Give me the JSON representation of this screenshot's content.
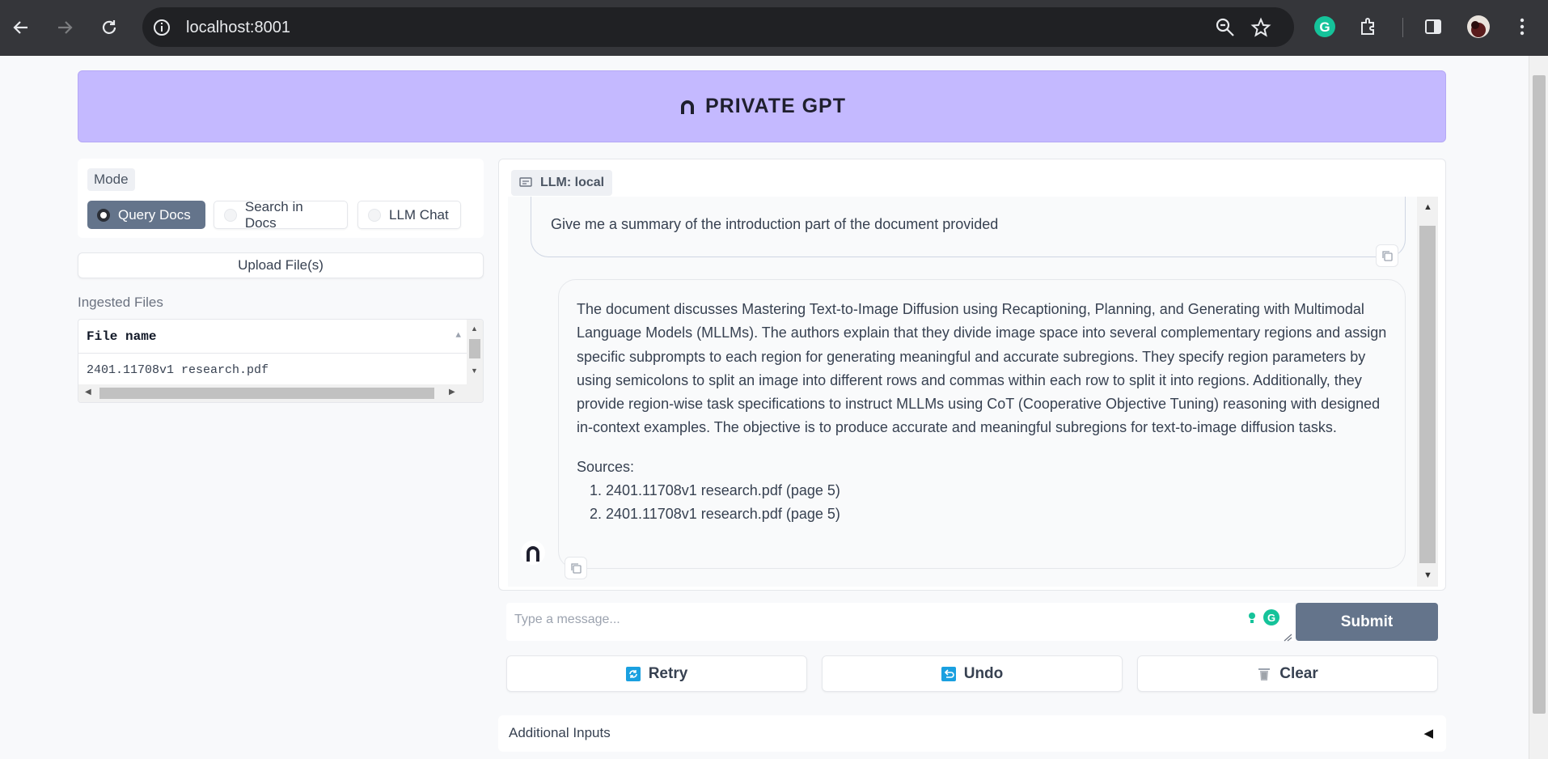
{
  "browser": {
    "url": "localhost:8001"
  },
  "header": {
    "title": "PRIVATE GPT"
  },
  "mode": {
    "label": "Mode",
    "options": [
      "Query Docs",
      "Search in Docs",
      "LLM Chat"
    ],
    "selected": "Query Docs"
  },
  "upload": {
    "label": "Upload File(s)"
  },
  "ingested": {
    "label": "Ingested Files",
    "column": "File name",
    "rows": [
      "2401.11708v1 research.pdf"
    ]
  },
  "chat": {
    "llm_label": "LLM: local",
    "user_message": "Give me a summary of the introduction part of the document provided",
    "bot_message": "The document discusses Mastering Text-to-Image Diffusion using Recaptioning, Planning, and Generating with Multimodal Language Models (MLLMs). The authors explain that they divide image space into several complementary regions and assign specific subprompts to each region for generating meaningful and accurate subregions. They specify region parameters by using semicolons to split an image into different rows and commas within each row to split it into regions. Additionally, they provide region-wise task specifications to instruct MLLMs using CoT (Cooperative Objective Tuning) reasoning with designed in-context examples. The objective is to produce accurate and meaningful subregions for text-to-image diffusion tasks.",
    "sources_label": "Sources:",
    "sources": [
      "2401.11708v1 research.pdf (page 5)",
      "2401.11708v1 research.pdf (page 5)"
    ]
  },
  "input": {
    "placeholder": "Type a message...",
    "submit_label": "Submit"
  },
  "actions": {
    "retry": "Retry",
    "undo": "Undo",
    "clear": "Clear"
  },
  "additional_inputs": {
    "label": "Additional Inputs"
  },
  "colors": {
    "banner": "#c4b9ff",
    "selected_mode": "#64748b",
    "submit": "#64748b",
    "chrome": "#35363a"
  }
}
